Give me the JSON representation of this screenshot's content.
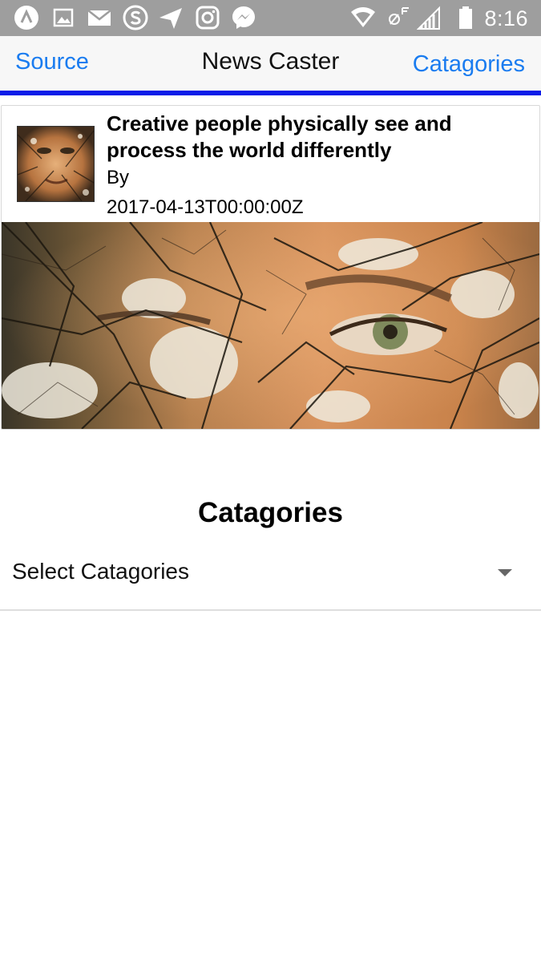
{
  "status_bar": {
    "time": "8:16",
    "left_icons": [
      "app-a-icon",
      "gallery-icon",
      "mail-icon",
      "skype-icon",
      "send-icon",
      "instagram-icon",
      "messenger-icon"
    ],
    "right_icons": [
      "wifi-icon",
      "no-sim-icon",
      "signal-icon",
      "battery-icon"
    ]
  },
  "navbar": {
    "left_label": "Source",
    "title": "News Caster",
    "right_label": "Catagories",
    "accent": "#1a7cf0",
    "rule_color": "#0a1de8"
  },
  "article": {
    "headline": "Creative people physically see and process the world differently",
    "byline": "By",
    "published": "2017-04-13T00:00:00Z"
  },
  "categories": {
    "title": "Catagories",
    "select_value": "Select Catagories"
  }
}
